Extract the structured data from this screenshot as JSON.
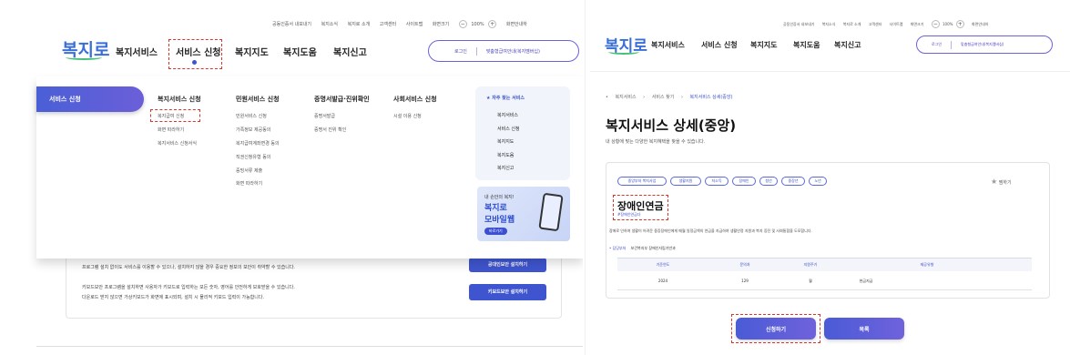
{
  "left": {
    "util_links": [
      "공동인증서 내보내기",
      "복지소식",
      "복지로 소개",
      "고객센터",
      "사이트맵",
      "화면크기"
    ],
    "zoom_minus": "−",
    "zoom_value": "100%",
    "zoom_plus": "+",
    "util_end": "화면안내하",
    "logo_text": "복지로",
    "gnb": [
      "복지서비스",
      "서비스 신청",
      "복지지도",
      "복지도움",
      "복지신고"
    ],
    "login_label": "로그인",
    "mode_label": "맞춤형급여안내(복지멤버십)",
    "side_title": "서비스 신청",
    "columns": [
      {
        "header": "복지서비스 신청",
        "items": [
          "복지급여 신청",
          "화면 따라하기",
          "복지서비스 신청서식"
        ]
      },
      {
        "header": "민원서비스 신청",
        "items": [
          "민원서비스 신청",
          "가족정보 제공동의",
          "복지급여계좌변경 동의",
          "직권신청유형 동의",
          "증빙서류 제출",
          "화면 따라하기"
        ]
      },
      {
        "header": "증명서발급·진위확인",
        "items": [
          "증명서발급",
          "증명서 진위 확인"
        ]
      },
      {
        "header": "사회서비스 신청",
        "items": [
          "시설 이용 신청"
        ]
      }
    ],
    "freq_title": "자주 찾는 서비스",
    "freq_items": [
      "복지서비스",
      "서비스 신청",
      "복지지도",
      "복지도움",
      "복지신고"
    ],
    "banner_small": "내 손안의 복지!",
    "banner_line1": "복지로",
    "banner_line2": "모바일웹",
    "banner_btn": "바로가기",
    "bg_line1": "프로그램 설치 없이도 서비스를 이용할 수 있으나, 설치하지 않을 경우 중요한 정보의 보안이 취약할 수 있습니다.",
    "bg_line2": "키보드보안 프로그램을 설치하면 사용자가 키보드로 입력하는 모든 숫자, 영어를 안전하게 보호받을 수 있습니다.",
    "bg_line3": "다운로드 받지 않으면 가상키보드가 화면에 표시되며, 설치 시 물리적 키보드 입력이 가능합니다.",
    "bg_btn1": "공대인보안 설치하기",
    "bg_btn2": "키보드보안 설치하기"
  },
  "right": {
    "util_links": [
      "공동인증서 내보내기",
      "복지소식",
      "복지로 소개",
      "고객센터",
      "사이트맵",
      "화면크기"
    ],
    "zoom_minus": "−",
    "zoom_value": "100%",
    "zoom_plus": "+",
    "util_end": "화면안내하",
    "logo_text": "복지로",
    "gnb": [
      "복지서비스",
      "서비스 신청",
      "복지지도",
      "복지도움",
      "복지신고"
    ],
    "login_label": "로그인",
    "mode_label": "맞춤형급여안내(복지멤버십)",
    "breadcrumb": [
      "복지서비스",
      "서비스 찾기",
      "복지서비스 상세(중앙)"
    ],
    "page_title": "복지서비스 상세(중앙)",
    "page_subtitle": "내 상황에 맞는 다양한 복지혜택을 찾을 수 있습니다.",
    "tags": [
      "중앙부처 복지사업",
      "생활지원",
      "저소득",
      "장애인",
      "청년",
      "중장년",
      "노년"
    ],
    "favorite_label": "찜하기",
    "service_name": "장애인연금",
    "service_code": "#장애인연금다",
    "service_desc": "장애로 인하여 생활이 어려운 중증장애인에게 매월 일정금액의 연금을 지급하여 생활안정 지원과 복지 증진 및 사회통합을 도모합니다.",
    "dept_label": "담당부처",
    "dept_value": "보건복지부 장애인자립기반과",
    "table_headers": [
      "기준연도",
      "문의처",
      "지원주기",
      "제공유형"
    ],
    "table_row": [
      "2024",
      "129",
      "월",
      "현금지급"
    ],
    "apply_button": "신청하기",
    "list_button": "목록"
  }
}
